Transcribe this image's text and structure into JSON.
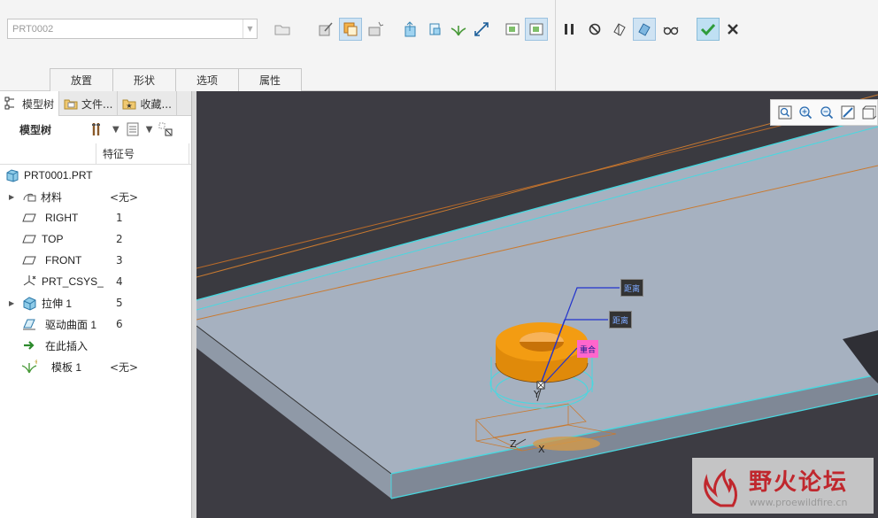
{
  "ribbon": {
    "part_select": {
      "value": "PRT0002",
      "placeholder": "PRT0002"
    },
    "tabs": [
      {
        "label": "放置"
      },
      {
        "label": "形状"
      },
      {
        "label": "选项"
      },
      {
        "label": "属性"
      }
    ],
    "icons": [
      "open-folder-icon",
      "sketch-edit-icon",
      "surface-copy-icon",
      "flip-icon",
      "solid-feature-icon",
      "surface-feature-icon",
      "template-icon",
      "scale-arrows-icon",
      "preview-window-icon",
      "preview-window-active-icon",
      "pause-icon",
      "no-preview-icon",
      "geometry-preview-icon",
      "feature-preview-icon",
      "glasses-icon",
      "confirm-check-icon",
      "cancel-x-icon"
    ],
    "accent": "#2f9c3b"
  },
  "panel": {
    "tabs": [
      {
        "label": "模型树",
        "icon": "model-tree-icon"
      },
      {
        "label": "文件...",
        "icon": "folder-browser-icon"
      },
      {
        "label": "收藏...",
        "icon": "favorites-icon"
      }
    ],
    "toolbar_label": "模型树",
    "column_header": "特征号",
    "root": "PRT0001.PRT",
    "rows": [
      {
        "name": "材料",
        "num": "<无>",
        "icon": "material-icon",
        "expandable": true
      },
      {
        "name": "RIGHT",
        "num": "1",
        "icon": "datum-plane-icon",
        "expandable": false
      },
      {
        "name": "TOP",
        "num": "2",
        "icon": "datum-plane-icon",
        "expandable": false
      },
      {
        "name": "FRONT",
        "num": "3",
        "icon": "datum-plane-icon",
        "expandable": false
      },
      {
        "name": "PRT_CSYS_",
        "num": "4",
        "icon": "csys-icon",
        "expandable": false
      },
      {
        "name": "拉伸 1",
        "num": "5",
        "icon": "extrude-icon",
        "expandable": true
      },
      {
        "name": "驱动曲面 1",
        "num": "6",
        "icon": "driving-surface-icon",
        "expandable": false
      },
      {
        "name": "在此插入",
        "num": "",
        "icon": "insert-here-arrow-icon",
        "expandable": false
      },
      {
        "name": "模板 1",
        "num": "<无>",
        "icon": "template-feature-icon",
        "expandable": false
      }
    ]
  },
  "viewport": {
    "background": "#3d3c43",
    "plate_color": "#a6b1c0",
    "edge_highlight": "#48d8e0",
    "part_color": "#f39c12",
    "tags": {
      "dim1": "距离",
      "dim2": "距离",
      "coincident": "重合"
    },
    "axis_labels": {
      "y": "Y",
      "z": "Z",
      "x": "X"
    },
    "view_tools": [
      "refit-icon",
      "zoom-in-icon",
      "zoom-out-icon",
      "repaint-icon",
      "saved-views-icon"
    ]
  },
  "watermark": {
    "title": "野火论坛",
    "url": "www.proewildfire.cn"
  }
}
